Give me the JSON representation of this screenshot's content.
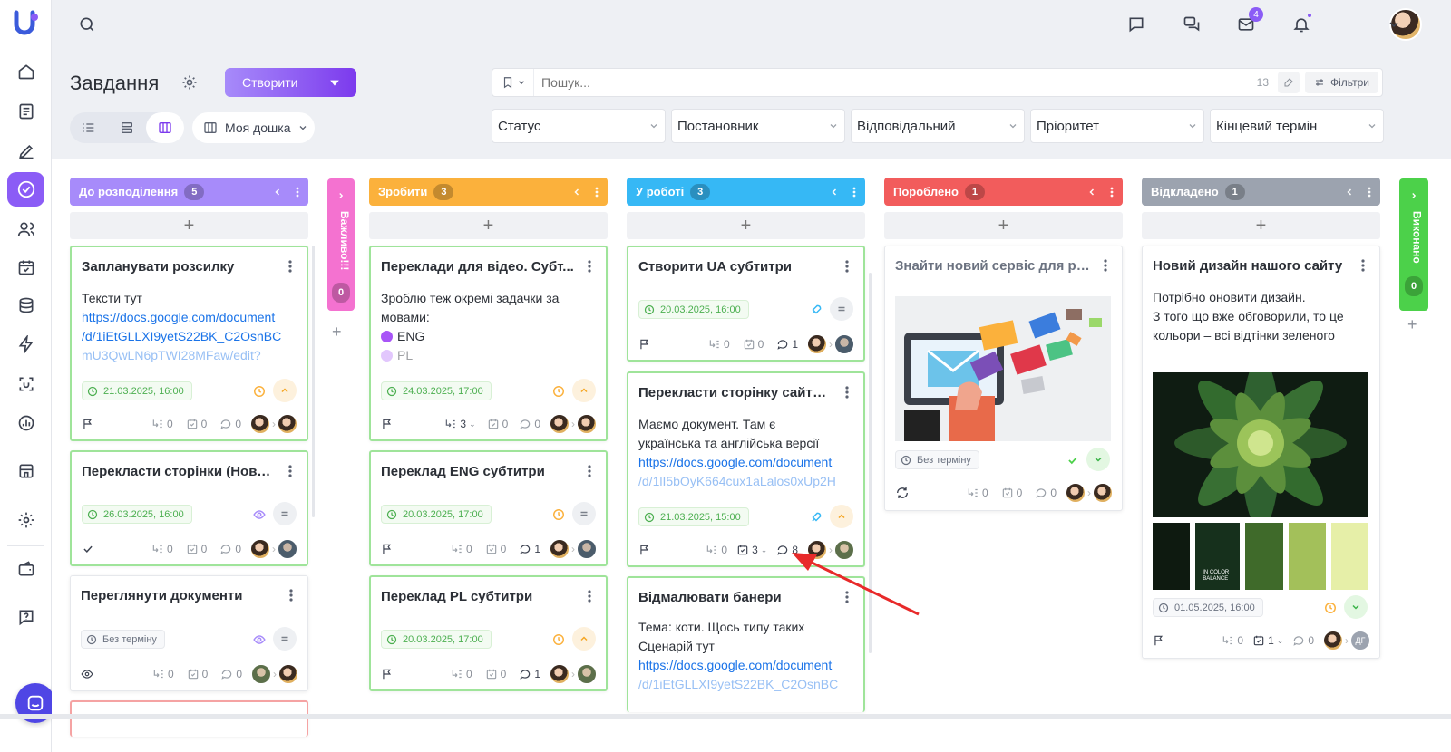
{
  "topbar": {
    "mail_badge": "4"
  },
  "header": {
    "title": "Завдання",
    "create_label": "Створити",
    "board_label": "Моя дошка",
    "search_placeholder": "Пошук...",
    "search_count": "13",
    "filters_label": "Фільтри",
    "filters": [
      "Статус",
      "Постановник",
      "Відповідальний",
      "Пріоритет",
      "Кінцевий термін"
    ]
  },
  "columns": [
    {
      "title": "До розподілення",
      "count": "5",
      "color": "#a78bfa"
    },
    {
      "title": "Зробити",
      "count": "3",
      "color": "#fbb13c"
    },
    {
      "title": "У роботі",
      "count": "3",
      "color": "#36b8f5"
    },
    {
      "title": "Пороблено",
      "count": "1",
      "color": "#f25c5c"
    },
    {
      "title": "Відкладено",
      "count": "1",
      "color": "#9ca3af"
    }
  ],
  "side_tabs": {
    "important": {
      "label": "Важливо!!!",
      "count": "0",
      "color": "#f472d0"
    },
    "done": {
      "label": "Виконано",
      "count": "0",
      "color": "#4cd14a"
    }
  },
  "cards": {
    "c1": {
      "title": "Запланувати розсилку",
      "desc": "Тексти тут",
      "link1": "https://docs.google.com/document",
      "link2": "/d/1iEtGLLXI9yetS22BK_C2OsnBC",
      "link3": "mU3QwLN6pTWI28MFaw/edit?",
      "date": "21.03.2025, 16:00",
      "subtasks": "0",
      "checklist": "0",
      "comments": "0"
    },
    "c2": {
      "title": "Перекласти сторінки (Нове ...",
      "date": "26.03.2025, 16:00",
      "subtasks": "0",
      "checklist": "0",
      "comments": "0"
    },
    "c3": {
      "title": "Переглянути документи",
      "date": "Без терміну",
      "subtasks": "0",
      "checklist": "0",
      "comments": "0"
    },
    "c4": {
      "title": "Переклади для відео. Субт...",
      "desc1": "Зроблю теж окремі задачки за",
      "desc2": "мовами:",
      "tag1": "ENG",
      "tag2": "PL",
      "date": "24.03.2025, 17:00",
      "subtasks": "3",
      "checklist": "0",
      "comments": "0"
    },
    "c5": {
      "title": "Переклад ENG субтитри",
      "date": "20.03.2025, 17:00",
      "subtasks": "0",
      "checklist": "0",
      "comments": "1"
    },
    "c6": {
      "title": "Переклад PL субтитри",
      "date": "20.03.2025, 17:00",
      "subtasks": "0",
      "checklist": "0",
      "comments": "1"
    },
    "c7": {
      "title": "Створити UA субтитри",
      "date": "20.03.2025, 16:00",
      "subtasks": "0",
      "checklist": "0",
      "comments": "1"
    },
    "c8": {
      "title": "Перекласти сторінку сайту ...",
      "desc1": "Маємо документ. Там є",
      "desc2": "українська та англійська версії",
      "link1": "https://docs.google.com/document",
      "link2": "/d/1lI5bOyK664cux1aLalos0xUp2H",
      "date": "21.03.2025, 15:00",
      "subtasks": "0",
      "checklist": "3",
      "comments": "8"
    },
    "c9": {
      "title": "Відмалювати банери",
      "desc1": "Тема: коти. Щось типу таких",
      "desc2": "Сценарій тут",
      "link1": "https://docs.google.com/document",
      "link2": "/d/1iEtGLLXI9yetS22BK_C2OsnBC"
    },
    "c10": {
      "title": "Знайти новий сервіс для ро...",
      "date": "Без терміну",
      "subtasks": "0",
      "checklist": "0",
      "comments": "0"
    },
    "c11": {
      "title": "Новий дизайн нашого сайту",
      "desc1": "Потрібно оновити дизайн.",
      "desc2": "З того що вже обговорили, то це",
      "desc3": "кольори – всі відтінки зеленого",
      "swatch_text": "IN COLOR BALANCE",
      "date": "01.05.2025, 16:00",
      "subtasks": "0",
      "checklist": "1",
      "comments": "0",
      "assignee_initials": "ДГ"
    }
  },
  "palette": [
    "#0e1a10",
    "#16301c",
    "#3f6a2a",
    "#a3c05a",
    "#e6efa8"
  ]
}
